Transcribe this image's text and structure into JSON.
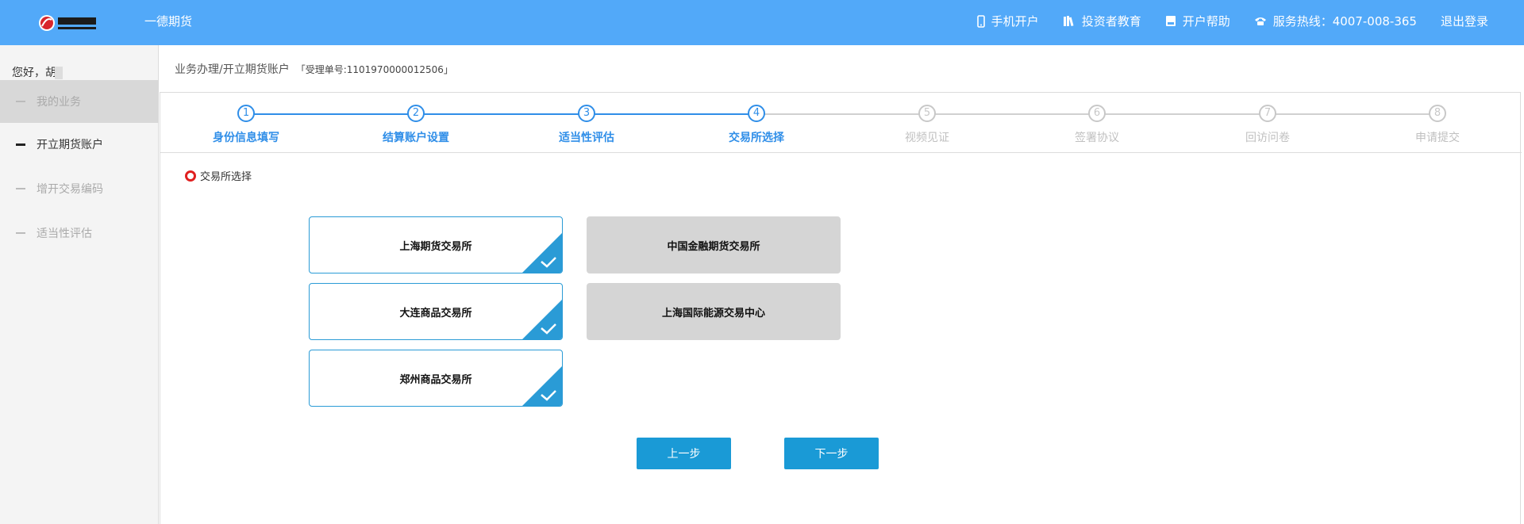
{
  "header": {
    "brand": "一德期货",
    "logo_icon": "first-futures-logo",
    "nav": [
      {
        "label": "手机开户",
        "icon": "mobile-icon"
      },
      {
        "label": "投资者教育",
        "icon": "books-icon"
      },
      {
        "label": "开户帮助",
        "icon": "help-book-icon"
      },
      {
        "label": "服务热线：4007-008-365",
        "icon": "phone-icon"
      },
      {
        "label": "退出登录",
        "icon": ""
      }
    ]
  },
  "sidebar": {
    "greeting": "您好，胡",
    "items": [
      {
        "label": "我的业务"
      },
      {
        "label": "开立期货账户"
      },
      {
        "label": "增开交易编码"
      },
      {
        "label": "适当性评估"
      }
    ]
  },
  "breadcrumb": {
    "path": "业务办理/开立期货账户",
    "order": "「受理单号:1101970000012506」"
  },
  "steps": [
    {
      "num": "1",
      "label": "身份信息填写",
      "state": "done"
    },
    {
      "num": "2",
      "label": "结算账户设置",
      "state": "done"
    },
    {
      "num": "3",
      "label": "适当性评估",
      "state": "done"
    },
    {
      "num": "4",
      "label": "交易所选择",
      "state": "current"
    },
    {
      "num": "5",
      "label": "视频见证",
      "state": "pending"
    },
    {
      "num": "6",
      "label": "签署协议",
      "state": "pending"
    },
    {
      "num": "7",
      "label": "回访问卷",
      "state": "pending"
    },
    {
      "num": "8",
      "label": "申请提交",
      "state": "pending"
    }
  ],
  "section_title": "交易所选择",
  "exchanges": [
    {
      "name": "上海期货交易所",
      "selected": true
    },
    {
      "name": "中国金融期货交易所",
      "selected": false
    },
    {
      "name": "大连商品交易所",
      "selected": true
    },
    {
      "name": "上海国际能源交易中心",
      "selected": false
    },
    {
      "name": "郑州商品交易所",
      "selected": true
    }
  ],
  "buttons": {
    "prev": "上一步",
    "next": "下一步"
  },
  "colors": {
    "header_bg": "#52a9f9",
    "accent": "#2f8ee8",
    "button": "#1a9ad6",
    "disabled_card": "#d5d5d5",
    "radio": "#e02020"
  }
}
